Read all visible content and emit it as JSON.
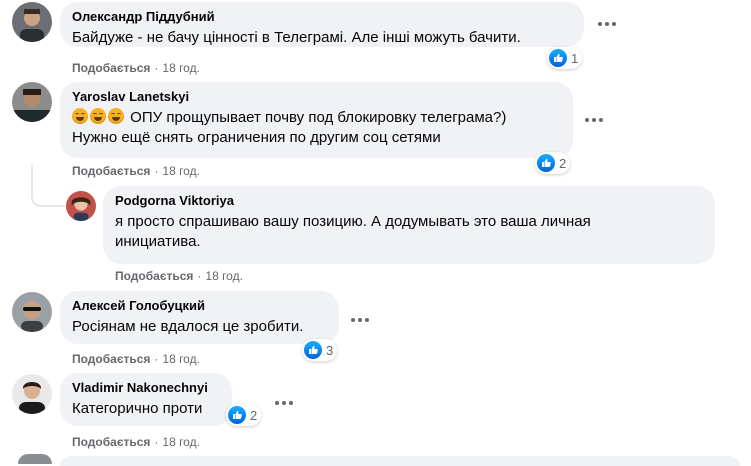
{
  "colors": {
    "bubble_bg": "#f0f2f5",
    "link_grey": "#65676b",
    "like_blue": "#1877f2"
  },
  "comments": [
    {
      "author": "Олександр Піддубний",
      "lines": [
        "Байдуже - не бачу цінності в Телеграмі. Але інші можуть бачити."
      ],
      "reactions": "1",
      "like_label": "Подобається",
      "time": "18 год."
    },
    {
      "author": "Yaroslav Lanetskyi",
      "lines": [
        "ОПУ прощупывает почву под блокировку телеграма?)",
        "Нужно ещё снять ограничения по другим соц сетями"
      ],
      "emoji_count": 3,
      "reactions": "2",
      "like_label": "Подобається",
      "time": "18 год."
    },
    {
      "author": "Podgorna Viktoriya",
      "lines": [
        "я просто спрашиваю вашу позицию. А додумывать это ваша личная",
        "инициатива."
      ],
      "like_label": "Подобається",
      "time": "18 год."
    },
    {
      "author": "Алексей Голобуцкий",
      "lines": [
        "Росіянам не вдалося це зробити."
      ],
      "reactions": "3",
      "like_label": "Подобається",
      "time": "18 год."
    },
    {
      "author": "Vladimir Nakonechnyi",
      "lines": [
        "Категорично проти"
      ],
      "reactions": "2",
      "like_label": "Подобається",
      "time": "18 год."
    }
  ],
  "icons": {
    "more": "more-options-icon",
    "like": "like-reaction-icon",
    "emoji": "laughing-emoji-icon"
  }
}
